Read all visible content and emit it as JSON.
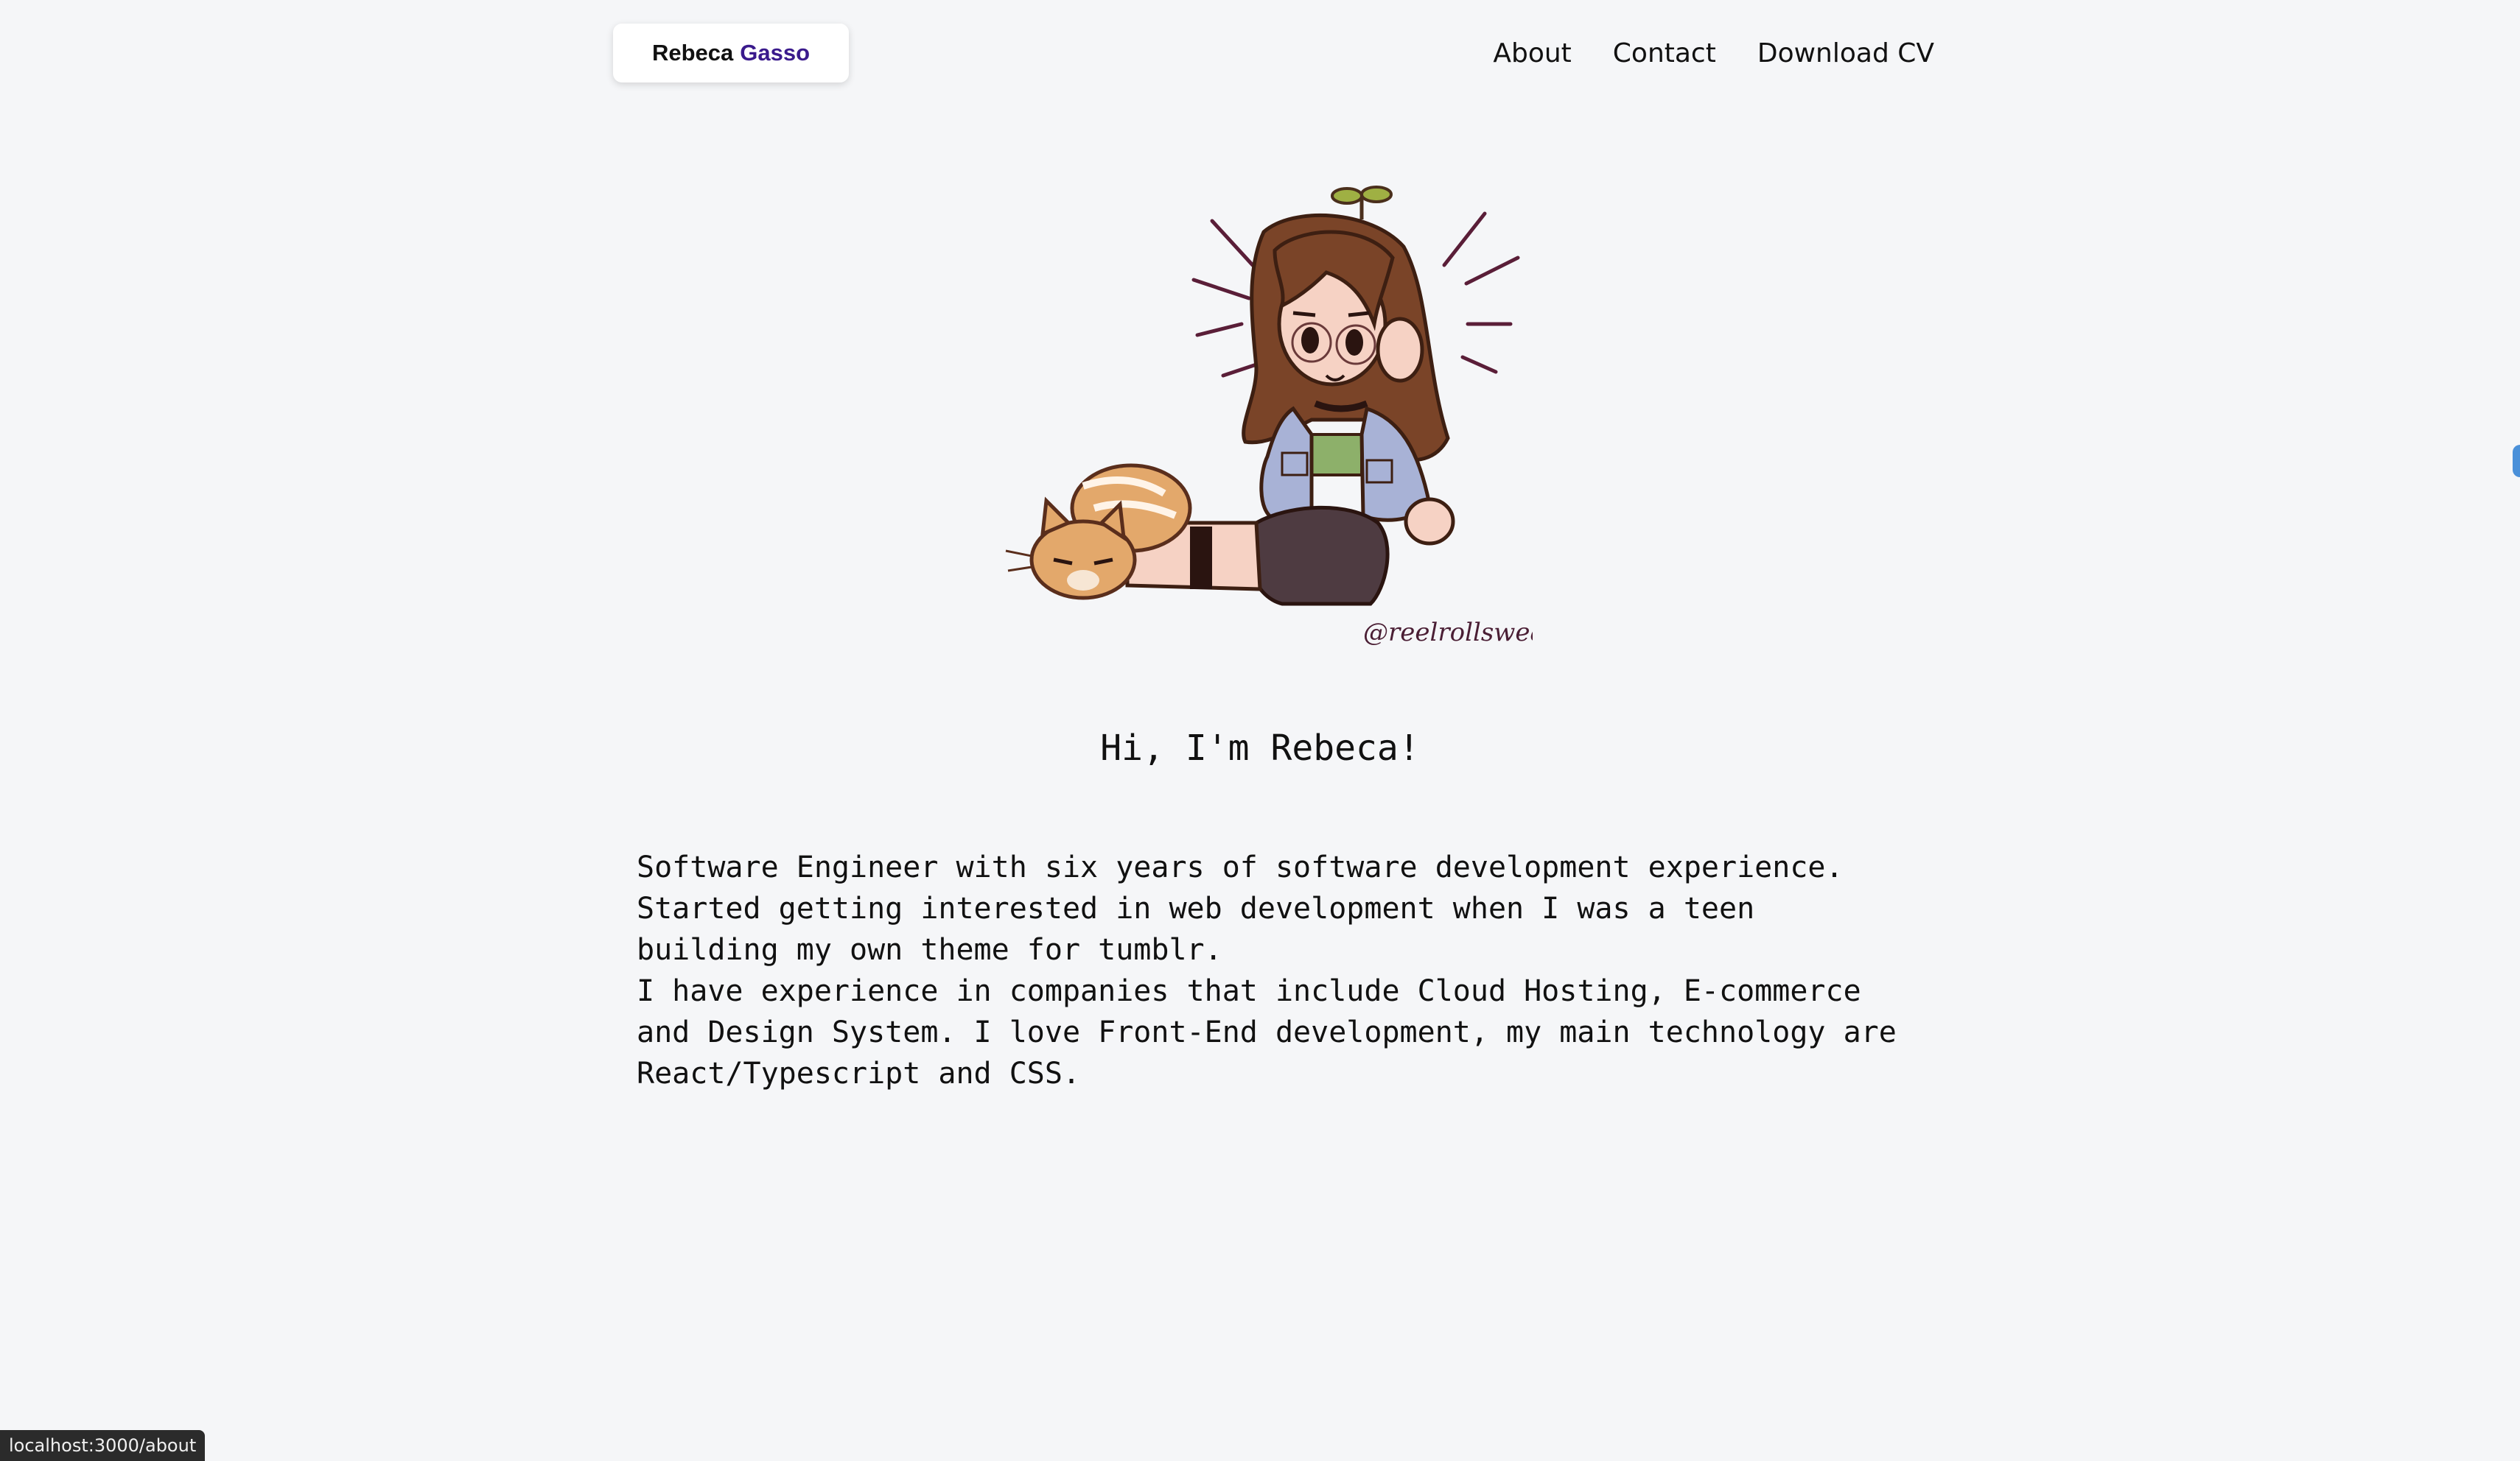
{
  "header": {
    "logo_first": "Rebeca",
    "logo_last": "Gasso",
    "nav": [
      {
        "label": "About"
      },
      {
        "label": "Contact"
      },
      {
        "label": "Download CV"
      }
    ]
  },
  "hero": {
    "avatar_icon": "cartoon-girl-with-cat-illustration",
    "signature": "@reelrollsweat",
    "title": "Hi, I'm Rebeca!",
    "bio": [
      "Software Engineer with six years of software development experience.",
      "Started getting interested in web development when I was a teen",
      "building my own theme for tumblr.",
      "I have experience in companies that include Cloud Hosting, E-commerce",
      "and Design System. I love Front-End development, my main technology are",
      "React/Typescript and CSS."
    ]
  },
  "status_bar": {
    "url": "localhost:3000/about"
  },
  "colors": {
    "background": "#f5f6f8",
    "logo_accent": "#3a1a8c",
    "text": "#111111"
  }
}
